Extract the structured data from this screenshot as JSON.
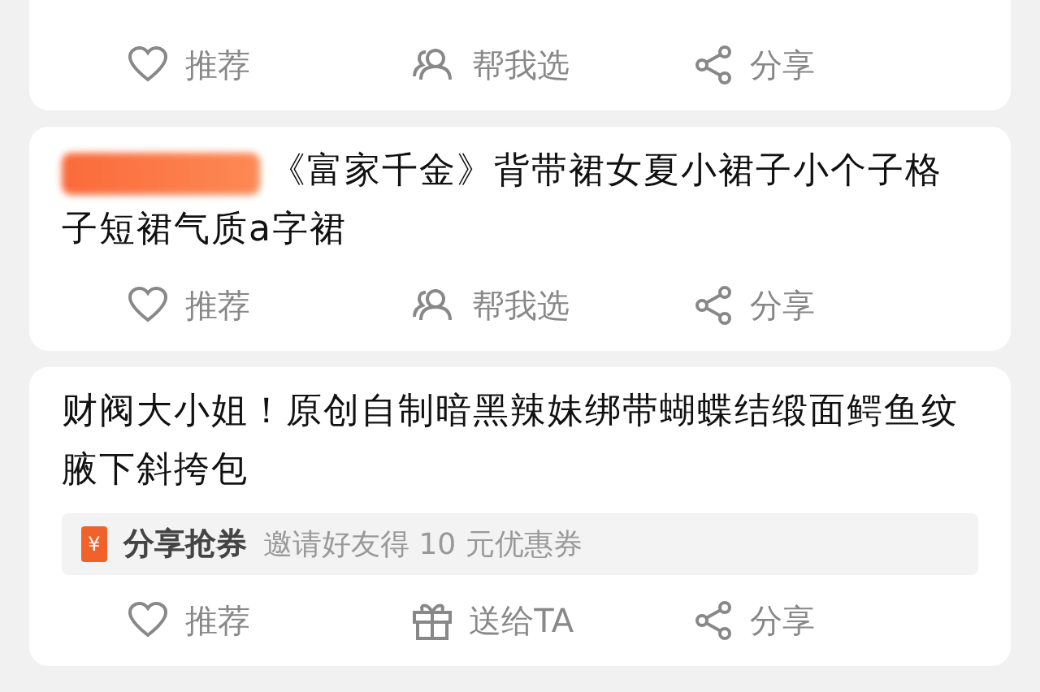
{
  "cards": [
    {
      "actions": [
        {
          "kind": "heart",
          "label": "推荐"
        },
        {
          "kind": "people",
          "label": "帮我选"
        },
        {
          "kind": "share",
          "label": "分享"
        }
      ]
    },
    {
      "redacted": true,
      "title": "《富家千金》背带裙女夏小裙子小个子格子短裙气质a字裙",
      "actions": [
        {
          "kind": "heart",
          "label": "推荐"
        },
        {
          "kind": "people",
          "label": "帮我选"
        },
        {
          "kind": "share",
          "label": "分享"
        }
      ]
    },
    {
      "redacted": false,
      "title": "财阀大小姐！原创自制暗黑辣妹绑带蝴蝶结缎面鳄鱼纹腋下斜挎包",
      "coupon": {
        "icon": "¥",
        "label": "分享抢券",
        "text": "邀请好友得 10 元优惠券"
      },
      "actions": [
        {
          "kind": "heart",
          "label": "推荐"
        },
        {
          "kind": "gift",
          "label": "送给TA"
        },
        {
          "kind": "share",
          "label": "分享"
        }
      ]
    }
  ]
}
